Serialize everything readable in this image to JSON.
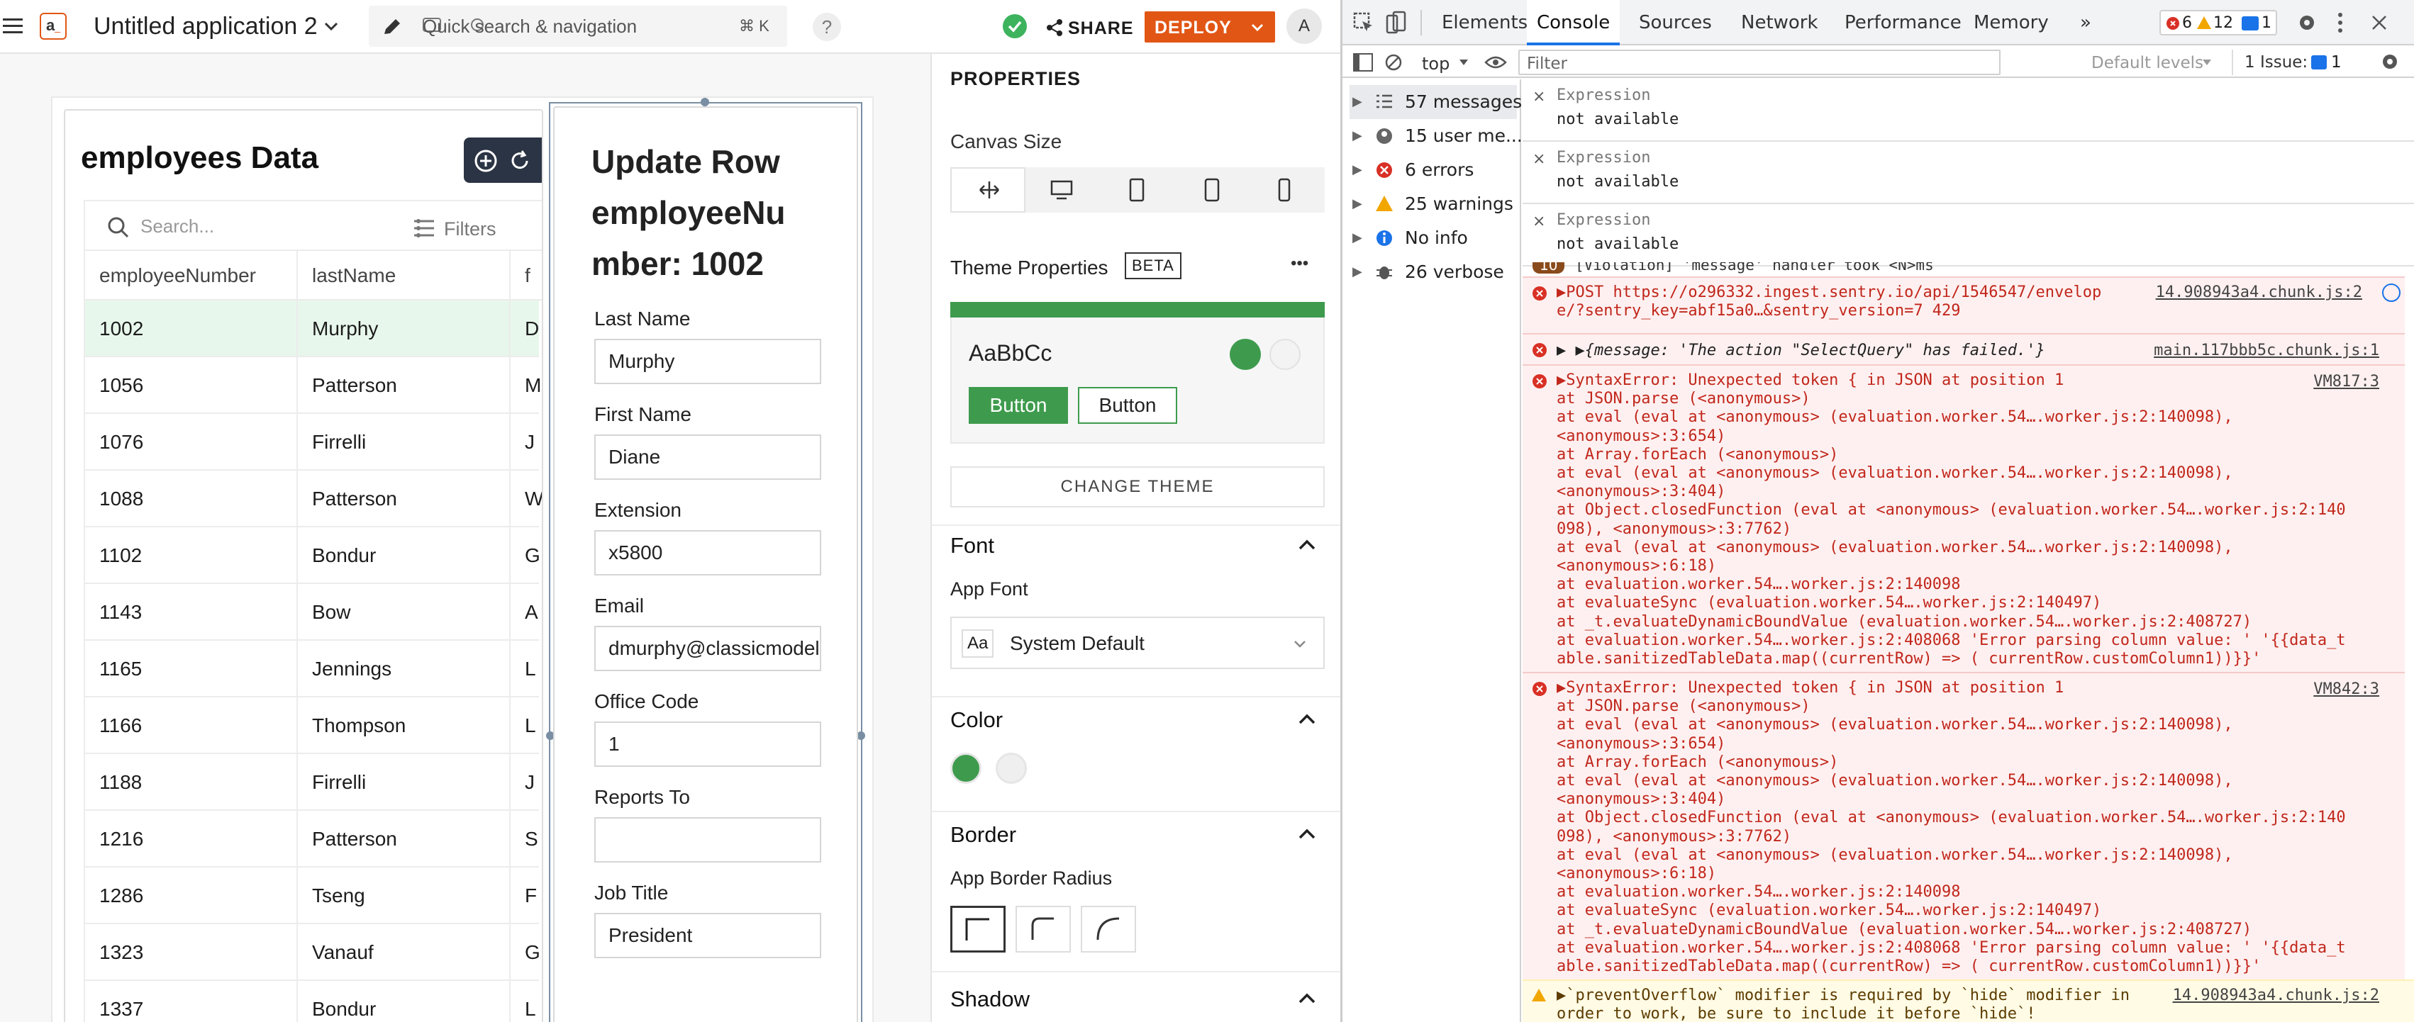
{
  "app": {
    "title": "Untitled application 2",
    "search_placeholder": "Quick search & navigation",
    "search_shortcut": "⌘ K",
    "help_label": "?",
    "share_label": "SHARE",
    "deploy_label": "DEPLOY",
    "avatar_initial": "A",
    "brand_color": "#e15615",
    "status_color": "#3db35e"
  },
  "table_widget": {
    "title": "employees Data",
    "search_placeholder": "Search...",
    "filters_label": "Filters",
    "columns": [
      "employeeNumber",
      "lastName",
      "f"
    ],
    "rows": [
      [
        "1002",
        "Murphy",
        "D"
      ],
      [
        "1056",
        "Patterson",
        "M"
      ],
      [
        "1076",
        "Firrelli",
        "J"
      ],
      [
        "1088",
        "Patterson",
        "W"
      ],
      [
        "1102",
        "Bondur",
        "G"
      ],
      [
        "1143",
        "Bow",
        "A"
      ],
      [
        "1165",
        "Jennings",
        "L"
      ],
      [
        "1166",
        "Thompson",
        "L"
      ],
      [
        "1188",
        "Firrelli",
        "J"
      ],
      [
        "1216",
        "Patterson",
        "S"
      ],
      [
        "1286",
        "Tseng",
        "F"
      ],
      [
        "1323",
        "Vanauf",
        "G"
      ],
      [
        "1337",
        "Bondur",
        "L"
      ]
    ],
    "selected_row_index": 0
  },
  "form_widget": {
    "title_line1": "Update Row",
    "title_line2": "employeeNu",
    "title_line3": "mber: 1002",
    "fields": [
      {
        "label": "Last Name",
        "value": "Murphy"
      },
      {
        "label": "First Name",
        "value": "Diane"
      },
      {
        "label": "Extension",
        "value": "x5800"
      },
      {
        "label": "Email",
        "value": "dmurphy@classicmodelcars.com"
      },
      {
        "label": "Office Code",
        "value": "1"
      },
      {
        "label": "Reports To",
        "value": ""
      },
      {
        "label": "Job Title",
        "value": "President"
      }
    ]
  },
  "properties": {
    "heading": "PROPERTIES",
    "canvas_size_label": "Canvas Size",
    "theme_label": "Theme Properties",
    "beta_label": "BETA",
    "more_label": "•••",
    "theme_preview_text": "AaBbCc",
    "button_primary": "Button",
    "button_secondary": "Button",
    "change_theme_label": "CHANGE THEME",
    "font_heading": "Font",
    "app_font_label": "App Font",
    "font_badge": "Aa",
    "font_value": "System Default",
    "color_heading": "Color",
    "border_heading": "Border",
    "border_radius_label": "App Border Radius",
    "shadow_heading": "Shadow",
    "theme_primary_color": "#3e9b4d",
    "theme_secondary_color": "#efefef"
  },
  "devtools": {
    "tabs": [
      "Elements",
      "Console",
      "Sources",
      "Network",
      "Performance",
      "Memory",
      "»"
    ],
    "active_tab": "Console",
    "error_count": "6",
    "warning_count": "12",
    "info_count": "1",
    "context_label": "top",
    "filter_placeholder": "Filter",
    "levels_label": "Default levels",
    "issues_label": "1 Issue:",
    "issues_count": "1",
    "sidebar": [
      {
        "label": "57 messages",
        "icon": "list-icon"
      },
      {
        "label": "15 user me...",
        "icon": "user-icon"
      },
      {
        "label": "6 errors",
        "icon": "error-icon"
      },
      {
        "label": "25 warnings",
        "icon": "warning-icon"
      },
      {
        "label": "No info",
        "icon": "info-icon"
      },
      {
        "label": "26 verbose",
        "icon": "bug-icon"
      }
    ],
    "expressions": [
      {
        "label": "Expression",
        "value": "not available"
      },
      {
        "label": "Expression",
        "value": "not available"
      },
      {
        "label": "Expression",
        "value": "not available"
      }
    ],
    "violation_badge": "10",
    "violation_text": "[Violation] 'message' handler took <N>ms",
    "log1": {
      "line1": "▶POST https://o296332.ingest.sentry.io/api/1546547/envelop",
      "line2": "e/?sentry_key=abf15a0…&sentry_version=7 429",
      "source": "14.908943a4.chunk.js:2"
    },
    "log2": {
      "line1": "▶ ▶{message: 'The action \"SelectQuery\" has failed.'}",
      "source": "main.117bbb5c.chunk.js:1"
    },
    "log3": {
      "source": "VM817:3",
      "lines": [
        "▶SyntaxError: Unexpected token { in JSON at position 1",
        "    at JSON.parse (<anonymous>)",
        "    at eval (eval at <anonymous> (evaluation.worker.54….worker.js:2:140098),",
        "<anonymous>:3:654)",
        "    at Array.forEach (<anonymous>)",
        "    at eval (eval at <anonymous> (evaluation.worker.54….worker.js:2:140098),",
        "<anonymous>:3:404)",
        "    at Object.closedFunction (eval at <anonymous> (evaluation.worker.54….worker.js:2:140",
        "098), <anonymous>:3:7762)",
        "    at eval (eval at <anonymous> (evaluation.worker.54….worker.js:2:140098),",
        "<anonymous>:6:18)",
        "    at evaluation.worker.54….worker.js:2:140098",
        "    at evaluateSync (evaluation.worker.54….worker.js:2:140497)",
        "    at _t.evaluateDynamicBoundValue (evaluation.worker.54….worker.js:2:408727)",
        "    at evaluation.worker.54….worker.js:2:408068 'Error parsing column value: ' '{{data_t",
        "able.sanitizedTableData.map((currentRow) => ( currentRow.customColumn1))}}'"
      ]
    },
    "log4": {
      "source": "VM842:3",
      "lines": [
        "▶SyntaxError: Unexpected token { in JSON at position 1",
        "    at JSON.parse (<anonymous>)",
        "    at eval (eval at <anonymous> (evaluation.worker.54….worker.js:2:140098),",
        "<anonymous>:3:654)",
        "    at Array.forEach (<anonymous>)",
        "    at eval (eval at <anonymous> (evaluation.worker.54….worker.js:2:140098),",
        "<anonymous>:3:404)",
        "    at Object.closedFunction (eval at <anonymous> (evaluation.worker.54….worker.js:2:140",
        "098), <anonymous>:3:7762)",
        "    at eval (eval at <anonymous> (evaluation.worker.54….worker.js:2:140098),",
        "<anonymous>:6:18)",
        "    at evaluation.worker.54….worker.js:2:140098",
        "    at evaluateSync (evaluation.worker.54….worker.js:2:140497)",
        "    at _t.evaluateDynamicBoundValue (evaluation.worker.54….worker.js:2:408727)",
        "    at evaluation.worker.54….worker.js:2:408068 'Error parsing column value: ' '{{data_t",
        "able.sanitizedTableData.map((currentRow) => ( currentRow.customColumn1))}}'"
      ]
    },
    "log5": {
      "line1": "▶`preventOverflow` modifier is required by `hide` modifier in",
      "line2": "order to work, be sure to include it before `hide`!",
      "source": "14.908943a4.chunk.js:2"
    }
  }
}
